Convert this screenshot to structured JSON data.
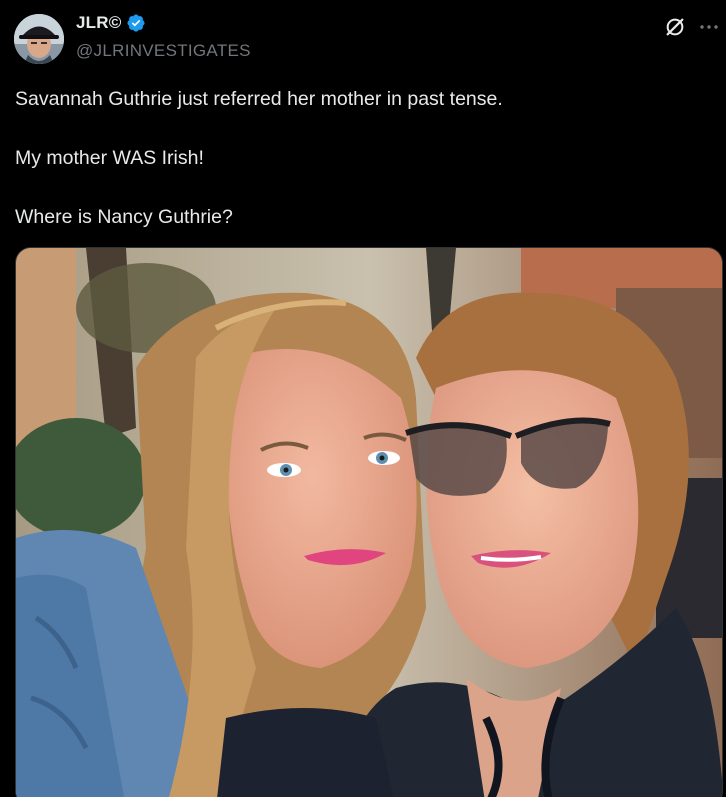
{
  "author": {
    "display_name": "JLR©",
    "handle": "@JLRINVESTIGATES",
    "verified_icon": "verified-badge-icon",
    "avatar_icon": "avatar-man-with-cap"
  },
  "actions": {
    "grok_icon": "grok-slash-circle-icon",
    "more_icon": "ellipsis-icon"
  },
  "tweet": {
    "paragraphs": [
      "Savannah Guthrie just referred her mother in past tense.",
      "My mother WAS Irish!",
      "Where is Nancy Guthrie?"
    ]
  },
  "media": {
    "type": "photo",
    "icon": "photo-two-women-selfie"
  },
  "colors": {
    "background": "#000000",
    "text": "#e7e9ea",
    "secondary_text": "#71767b",
    "verified": "#1d9bf0"
  }
}
